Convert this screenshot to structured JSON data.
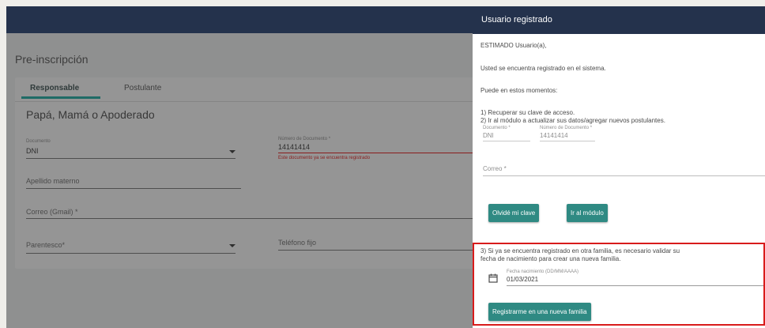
{
  "page": {
    "title": "Pre-inscripción",
    "tabs": [
      {
        "label": "Responsable",
        "active": true
      },
      {
        "label": "Postulante",
        "active": false
      }
    ],
    "section_title": "Papá, Mamá o Apoderado",
    "form": {
      "documento": {
        "label": "Documento",
        "value": "DNI"
      },
      "numero_documento": {
        "label": "Número de Documento *",
        "value": "14141414",
        "error": "Este documento ya se encuentra registrado"
      },
      "apellido_materno": {
        "placeholder": "Apellido materno"
      },
      "correo": {
        "placeholder": "Correo (Gmail) *"
      },
      "parentesco": {
        "placeholder": "Parentesco*"
      },
      "telefono": {
        "placeholder": "Teléfono fijo"
      }
    }
  },
  "dialog": {
    "title": "Usuario registrado",
    "greeting": "ESTIMADO Usuario(a),",
    "registered_msg": "Usted se encuentra registrado en el sistema.",
    "can_msg": "Puede en estos momentos:",
    "option1": "1) Recuperar su clave de acceso.",
    "option2": "2) Ir al módulo a actualizar sus datos/agregar nuevos postulantes.",
    "documento": {
      "label": "Documento *",
      "value": "DNI"
    },
    "numero": {
      "label": "Número de Documento *",
      "value": "14141414"
    },
    "correo_placeholder": "Correo *",
    "btn_forgot": "Olvidé mi clave",
    "btn_module": "Ir al módulo",
    "option3_line1": "3) Si ya se encuentra registrado en otra familia, es necesario validar su",
    "option3_line2": "fecha de nacimiento para crear una nueva familia.",
    "fecha": {
      "label": "Fecha nacimiento (DD/MM/AAAA)",
      "value": "01/03/2021"
    },
    "btn_new_family": "Registrarme en una nueva familia"
  },
  "colors": {
    "header": "#24324c",
    "accent": "#2f8a83",
    "highlight": "#d81b1b",
    "error": "#8a1d1d"
  },
  "icons": {
    "date": "calendar-icon",
    "select": "caret-down-icon"
  }
}
